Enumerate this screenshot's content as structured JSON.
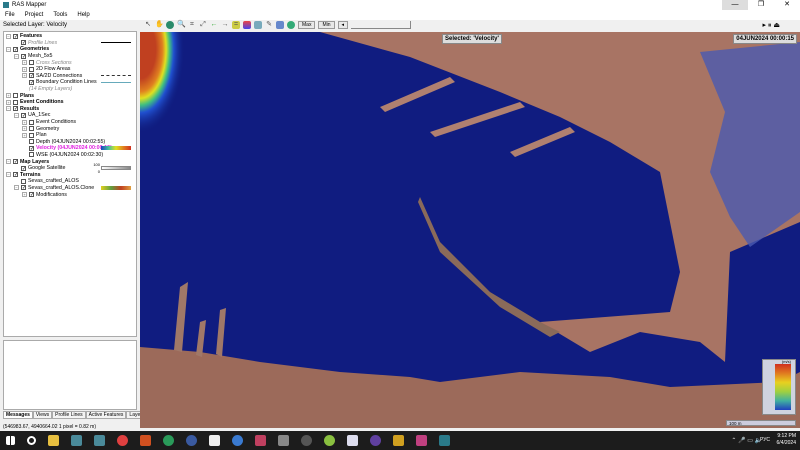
{
  "window": {
    "title": "RAS Mapper",
    "minimize": "—",
    "restore": "❐",
    "close": "✕"
  },
  "menu": [
    "File",
    "Project",
    "Tools",
    "Help"
  ],
  "selected_layer": "Selected Layer: Velocity",
  "toolbar": {
    "max": "Max",
    "min": "Min",
    "step": "◂"
  },
  "tree": [
    {
      "label": "Features",
      "level": 0,
      "bold": true,
      "checked": true,
      "exp": "−"
    },
    {
      "label": "Profile Lines",
      "level": 1,
      "italic": true,
      "checked": true,
      "legend": "line"
    },
    {
      "label": "Geometries",
      "level": 0,
      "bold": true,
      "checked": true,
      "exp": "−"
    },
    {
      "label": "Mesh_5x5",
      "level": 1,
      "checked": true,
      "exp": "−"
    },
    {
      "label": "Cross Sections",
      "level": 2,
      "italic": true,
      "checked": false,
      "exp": "+"
    },
    {
      "label": "2D Flow Areas",
      "level": 2,
      "checked": false,
      "exp": "+"
    },
    {
      "label": "SA/2D Connections",
      "level": 2,
      "checked": true,
      "exp": "+",
      "legend": "dash"
    },
    {
      "label": "Boundary Condition Lines",
      "level": 2,
      "checked": true,
      "legend": "teal"
    },
    {
      "label": "(14 Empty Layers)",
      "level": 2,
      "italic": true,
      "nocb": true
    },
    {
      "label": "Plans",
      "level": 0,
      "bold": true,
      "checked": false,
      "exp": "+"
    },
    {
      "label": "Event Conditions",
      "level": 0,
      "bold": true,
      "checked": false,
      "exp": "+"
    },
    {
      "label": "Results",
      "level": 0,
      "bold": true,
      "checked": true,
      "exp": "−"
    },
    {
      "label": "UA_1Sec",
      "level": 1,
      "checked": true,
      "exp": "−"
    },
    {
      "label": "Event Conditions",
      "level": 2,
      "checked": false,
      "exp": "+"
    },
    {
      "label": "Geometry",
      "level": 2,
      "checked": false,
      "exp": "+"
    },
    {
      "label": "Plan",
      "level": 2,
      "checked": false,
      "exp": "+"
    },
    {
      "label": "Depth (04JUN2024 00:02:55)",
      "level": 2,
      "checked": false
    },
    {
      "label": "Velocity (04JUN2024 00:00:15)",
      "level": 2,
      "checked": true,
      "selected": true,
      "legend": "ramp"
    },
    {
      "label": "WSE (04JUN2024 00:02:30)",
      "level": 2,
      "checked": false
    },
    {
      "label": "Map Layers",
      "level": 0,
      "bold": true,
      "checked": true,
      "exp": "−"
    },
    {
      "label": "Google Satellite",
      "level": 1,
      "checked": true,
      "legend": "opacity"
    },
    {
      "label": "Terrains",
      "level": 0,
      "bold": true,
      "checked": true,
      "exp": "−"
    },
    {
      "label": "Sevas_crafted_ALOS",
      "level": 1,
      "checked": false
    },
    {
      "label": "Sevas_crafted_ALOS.Clone",
      "level": 1,
      "checked": true,
      "exp": "−",
      "legend": "terrain"
    },
    {
      "label": "Modifications",
      "level": 2,
      "checked": true,
      "exp": "+"
    }
  ],
  "opacity_labels": {
    "top": "100",
    "bottom": "0"
  },
  "tabs": [
    "Messages",
    "Views",
    "Profile Lines",
    "Active Features",
    "Layer"
  ],
  "status": "(546983.67, 4940664.02   1 pixel = 0.82 m)",
  "map": {
    "selected": "Selected: 'Velocity'",
    "time": "04JUN2024 00:00:15",
    "scale": "100 m",
    "legend_title": "(m/s)"
  },
  "tray": {
    "lang": "РУС",
    "time": "9:12 PM",
    "date": "6/4/2024",
    "icons": "⌃ 🎤 ▭ 🔈"
  },
  "colors": {
    "water": "#0e1a78",
    "land": "#b07a6a",
    "selected_text": "#e020e0"
  }
}
